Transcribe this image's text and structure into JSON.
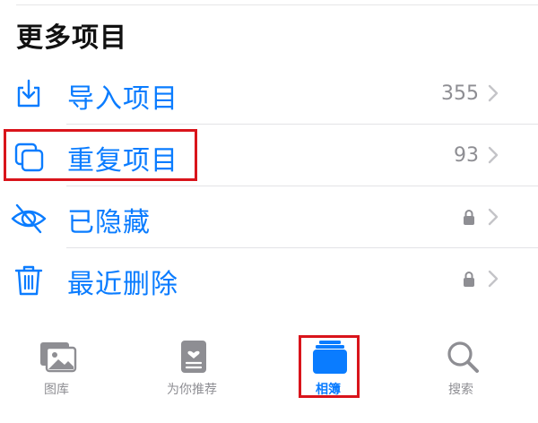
{
  "section": {
    "title": "更多项目"
  },
  "items": [
    {
      "label": "导入项目",
      "count": "355",
      "icon": "import-icon"
    },
    {
      "label": "重复项目",
      "count": "93",
      "icon": "duplicates-icon"
    },
    {
      "label": "已隐藏",
      "icon": "hidden-eye-icon",
      "locked": true
    },
    {
      "label": "最近删除",
      "icon": "trash-icon",
      "locked": true
    }
  ],
  "tabs": [
    {
      "label": "图库",
      "icon": "photos-icon"
    },
    {
      "label": "为你推荐",
      "icon": "for-you-icon"
    },
    {
      "label": "相簿",
      "icon": "albums-icon",
      "active": true
    },
    {
      "label": "搜索",
      "icon": "search-icon"
    }
  ],
  "colors": {
    "accent": "#0a7cff",
    "muted": "#8e8e93",
    "highlight": "#d9141b"
  }
}
